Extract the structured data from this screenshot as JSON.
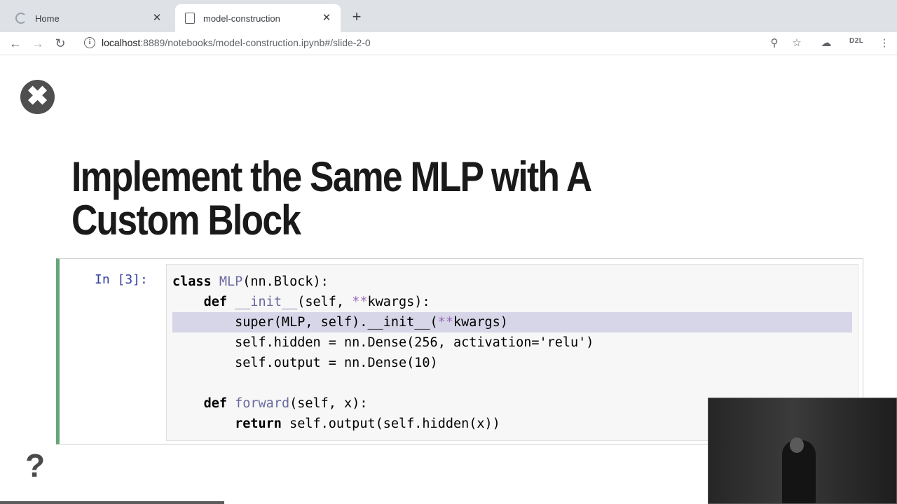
{
  "browser": {
    "tabs": [
      {
        "label": "Home"
      },
      {
        "label": "model-construction"
      }
    ],
    "url_host": "localhost",
    "url_rest": ":8889/notebooks/model-construction.ipynb#/slide-2-0",
    "extension_label": "D2L"
  },
  "slide": {
    "title": "Implement the Same MLP with A Custom Block",
    "cell_prompt": "In [3]:",
    "code": {
      "l1_kw": "class",
      "l1_name": "MLP",
      "l1_rest": "(nn.Block):",
      "l2_indent": "    ",
      "l2_kw": "def",
      "l2_name": "__init__",
      "l2_a": "(self, ",
      "l2_op": "**",
      "l2_b": "kwargs):",
      "l3_a": "        super(MLP, self).__init__(",
      "l3_op": "**",
      "l3_b": "kwargs)",
      "l4": "        self.hidden = nn.Dense(256, activation='relu')",
      "l5": "        self.output = nn.Dense(10)",
      "l7_indent": "    ",
      "l7_kw": "def",
      "l7_name": "forward",
      "l7_rest": "(self, x):",
      "l8_indent": "        ",
      "l8_kw": "return",
      "l8_rest": " self.output(self.hidden(x))"
    }
  },
  "icons": [
    "refresh-favicon",
    "notebook-favicon",
    "close-icon",
    "plus-icon",
    "back-arrow-icon",
    "forward-arrow-icon",
    "reload-icon",
    "info-icon",
    "zoom-icon",
    "star-icon",
    "cloud-icon",
    "menu-dots-icon",
    "close-slide-icon",
    "help-icon"
  ]
}
